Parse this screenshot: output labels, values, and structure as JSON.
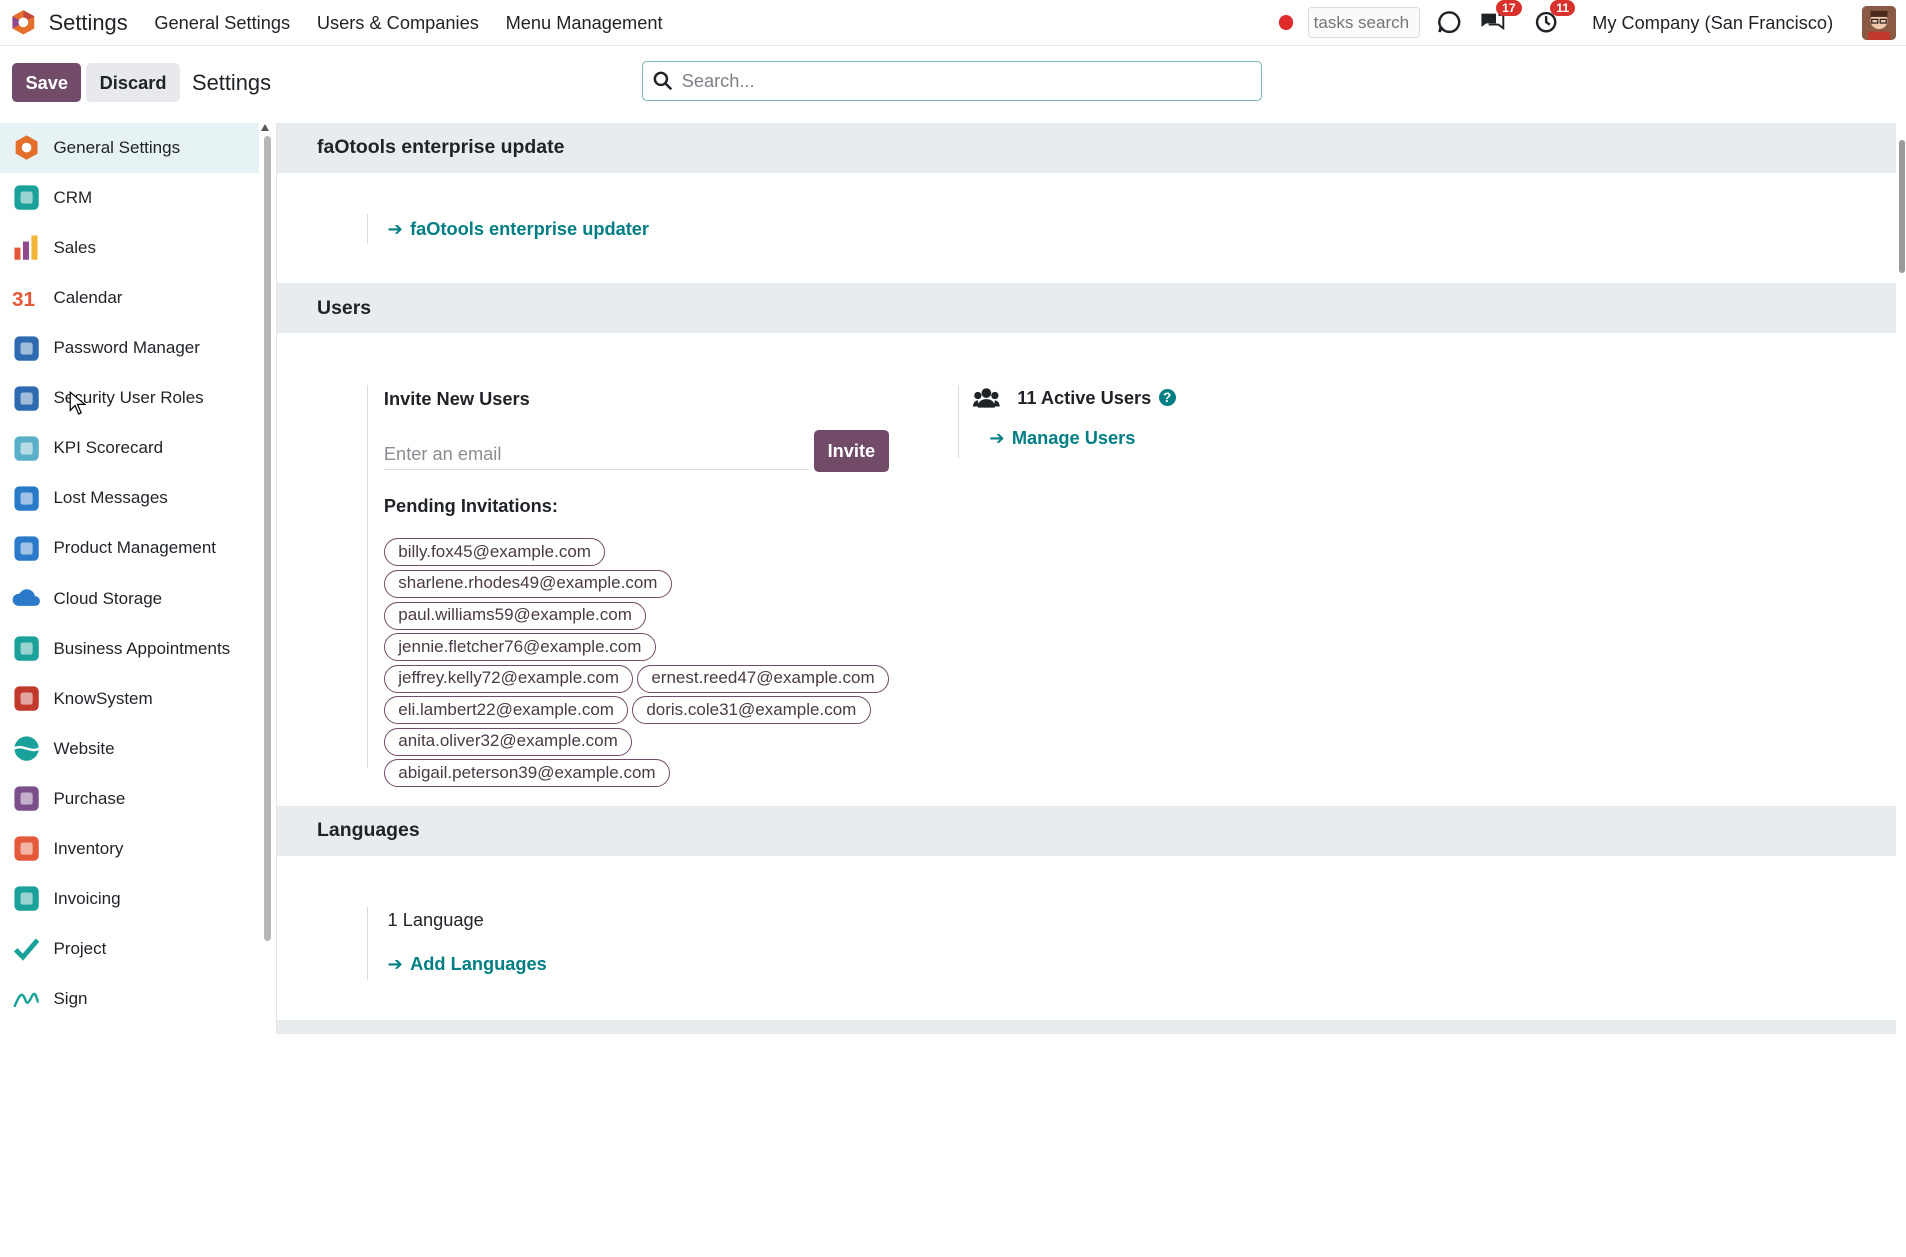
{
  "topbar": {
    "app_name": "Settings",
    "nav": [
      "General Settings",
      "Users & Companies",
      "Menu Management"
    ],
    "tasks_placeholder": "tasks search",
    "chat_badge": "17",
    "activity_badge": "11",
    "company": "My Company (San Francisco)"
  },
  "controlbar": {
    "save_label": "Save",
    "discard_label": "Discard",
    "title": "Settings",
    "search_placeholder": "Search..."
  },
  "sidebar": {
    "items": [
      {
        "label": "General Settings",
        "icon": "odoo-logo-icon",
        "color": "#e46e2b"
      },
      {
        "label": "CRM",
        "icon": "crm-icon",
        "color": "#1aa19a"
      },
      {
        "label": "Sales",
        "icon": "sales-icon",
        "color": "#e5593b"
      },
      {
        "label": "Calendar",
        "icon": "calendar-icon",
        "color": "#e5593b"
      },
      {
        "label": "Password Manager",
        "icon": "password-manager-icon",
        "color": "#2e6ab0"
      },
      {
        "label": "Security User Roles",
        "icon": "security-roles-icon",
        "color": "#2e6ab0"
      },
      {
        "label": "KPI Scorecard",
        "icon": "kpi-scorecard-icon",
        "color": "#5ab0c8"
      },
      {
        "label": "Lost Messages",
        "icon": "lost-messages-icon",
        "color": "#2a7ac9"
      },
      {
        "label": "Product Management",
        "icon": "product-management-icon",
        "color": "#2a7ac9"
      },
      {
        "label": "Cloud Storage",
        "icon": "cloud-storage-icon",
        "color": "#2a7ac9"
      },
      {
        "label": "Business Appointments",
        "icon": "appointments-icon",
        "color": "#1aa19a"
      },
      {
        "label": "KnowSystem",
        "icon": "knowsystem-icon",
        "color": "#c0392b"
      },
      {
        "label": "Website",
        "icon": "website-icon",
        "color": "#1aa19a"
      },
      {
        "label": "Purchase",
        "icon": "purchase-icon",
        "color": "#7a4f8a"
      },
      {
        "label": "Inventory",
        "icon": "inventory-icon",
        "color": "#e5593b"
      },
      {
        "label": "Invoicing",
        "icon": "invoicing-icon",
        "color": "#1aa19a"
      },
      {
        "label": "Project",
        "icon": "project-icon",
        "color": "#1aa19a"
      },
      {
        "label": "Sign",
        "icon": "sign-icon",
        "color": "#1aa19a"
      }
    ]
  },
  "main": {
    "faotools": {
      "header": "faOtools enterprise update",
      "link": "faOtools enterprise updater"
    },
    "users": {
      "header": "Users",
      "invite_title": "Invite New Users",
      "email_placeholder": "Enter an email",
      "invite_label": "Invite",
      "pending_title": "Pending Invitations:",
      "pending_rows": [
        [
          "billy.fox45@example.com"
        ],
        [
          "sharlene.rhodes49@example.com"
        ],
        [
          "paul.williams59@example.com"
        ],
        [
          "jennie.fletcher76@example.com"
        ],
        [
          "jeffrey.kelly72@example.com",
          "ernest.reed47@example.com"
        ],
        [
          "eli.lambert22@example.com",
          "doris.cole31@example.com"
        ],
        [
          "anita.oliver32@example.com"
        ],
        [
          "abigail.peterson39@example.com"
        ]
      ],
      "active_users": "11 Active Users",
      "help": "?",
      "manage_link": "Manage Users"
    },
    "languages": {
      "header": "Languages",
      "count": "1 Language",
      "add_link": "Add Languages"
    }
  },
  "colors": {
    "brand": "#714b67",
    "link": "#017e84",
    "badge": "#d9312b"
  }
}
